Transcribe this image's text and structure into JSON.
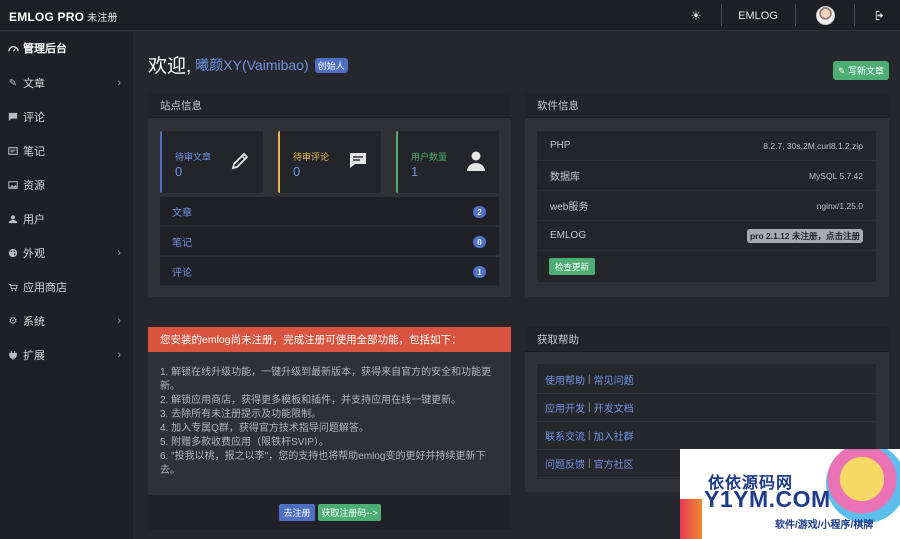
{
  "topbar": {
    "brand": "EMLOG PRO",
    "brand_sub": "未注册",
    "emlog_link": "EMLOG",
    "icons": {
      "theme": "sun-icon",
      "avatar": "avatar",
      "logout": "logout-icon"
    }
  },
  "sidebar": {
    "items": [
      {
        "label": "管理后台",
        "icon": "dashboard-icon",
        "has_children": false,
        "active": true
      },
      {
        "label": "文章",
        "icon": "pencil-icon",
        "has_children": true
      },
      {
        "label": "评论",
        "icon": "comment-icon",
        "has_children": false
      },
      {
        "label": "笔记",
        "icon": "note-icon",
        "has_children": false
      },
      {
        "label": "资源",
        "icon": "image-icon",
        "has_children": false
      },
      {
        "label": "用户",
        "icon": "user-icon",
        "has_children": false
      },
      {
        "label": "外观",
        "icon": "palette-icon",
        "has_children": true
      },
      {
        "label": "应用商店",
        "icon": "store-icon",
        "has_children": false
      },
      {
        "label": "系统",
        "icon": "gear-icon",
        "has_children": true
      },
      {
        "label": "扩展",
        "icon": "plug-icon",
        "has_children": true
      }
    ]
  },
  "main": {
    "welcome": "欢迎,",
    "username": "曦颜XY(Vaimibao)",
    "role_badge": "创始人",
    "write_button": "✎ 写新文章"
  },
  "site_info": {
    "title": "站点信息",
    "stats": [
      {
        "label": "待审文章",
        "value": "0",
        "color": "#4f6fc4"
      },
      {
        "label": "待审评论",
        "value": "0",
        "color": "#e7b94a"
      },
      {
        "label": "用户数量",
        "value": "1",
        "color": "#4cae72"
      }
    ],
    "rows": [
      {
        "label": "文章",
        "count": "2"
      },
      {
        "label": "笔记",
        "count": "0"
      },
      {
        "label": "评论",
        "count": "1"
      }
    ]
  },
  "software": {
    "title": "软件信息",
    "rows": [
      {
        "label": "PHP",
        "value": "8.2.7, 30s,2M,curl8.1.2,zip"
      },
      {
        "label": "数据库",
        "value": "MySQL 5.7.42"
      },
      {
        "label": "web服务",
        "value": "nginx/1.25.0"
      },
      {
        "label": "EMLOG",
        "value": "pro 2.1.12 未注册，点击注册"
      }
    ],
    "check_button": "检查更新"
  },
  "register_notice": {
    "title": "您安装的emlog尚未注册，完成注册可使用全部功能，包括如下：",
    "lines": [
      "1. 解锁在线升级功能，一键升级到最新版本，获得来自官方的安全和功能更",
      "新。",
      "2. 解锁应用商店，获得更多模板和插件，并支持应用在线一键更新。",
      "3. 去除所有未注册提示及功能限制。",
      "4. 加入专属Q群，获得官方技术指导问题解答。",
      "5. 附赠多款收费应用（限铁杆SVIP）。",
      "6. \"投我以桃，报之以李\"，您的支持也将帮助emlog变的更好并持续更新下",
      "去。"
    ],
    "register_button": "去注册",
    "get_code_button": "获取注册码-->"
  },
  "help": {
    "title": "获取帮助",
    "rows": [
      {
        "a": "使用帮助",
        "b": "常见问题"
      },
      {
        "a": "应用开发",
        "b": "开发文档"
      },
      {
        "a": "联系交流",
        "b": "加入社群"
      },
      {
        "a": "问题反馈",
        "b": "官方社区"
      }
    ]
  },
  "watermark": {
    "cn": "依依源码网",
    "en": "Y1YM.COM",
    "tagline": "软件/游戏/小程序/棋牌"
  }
}
